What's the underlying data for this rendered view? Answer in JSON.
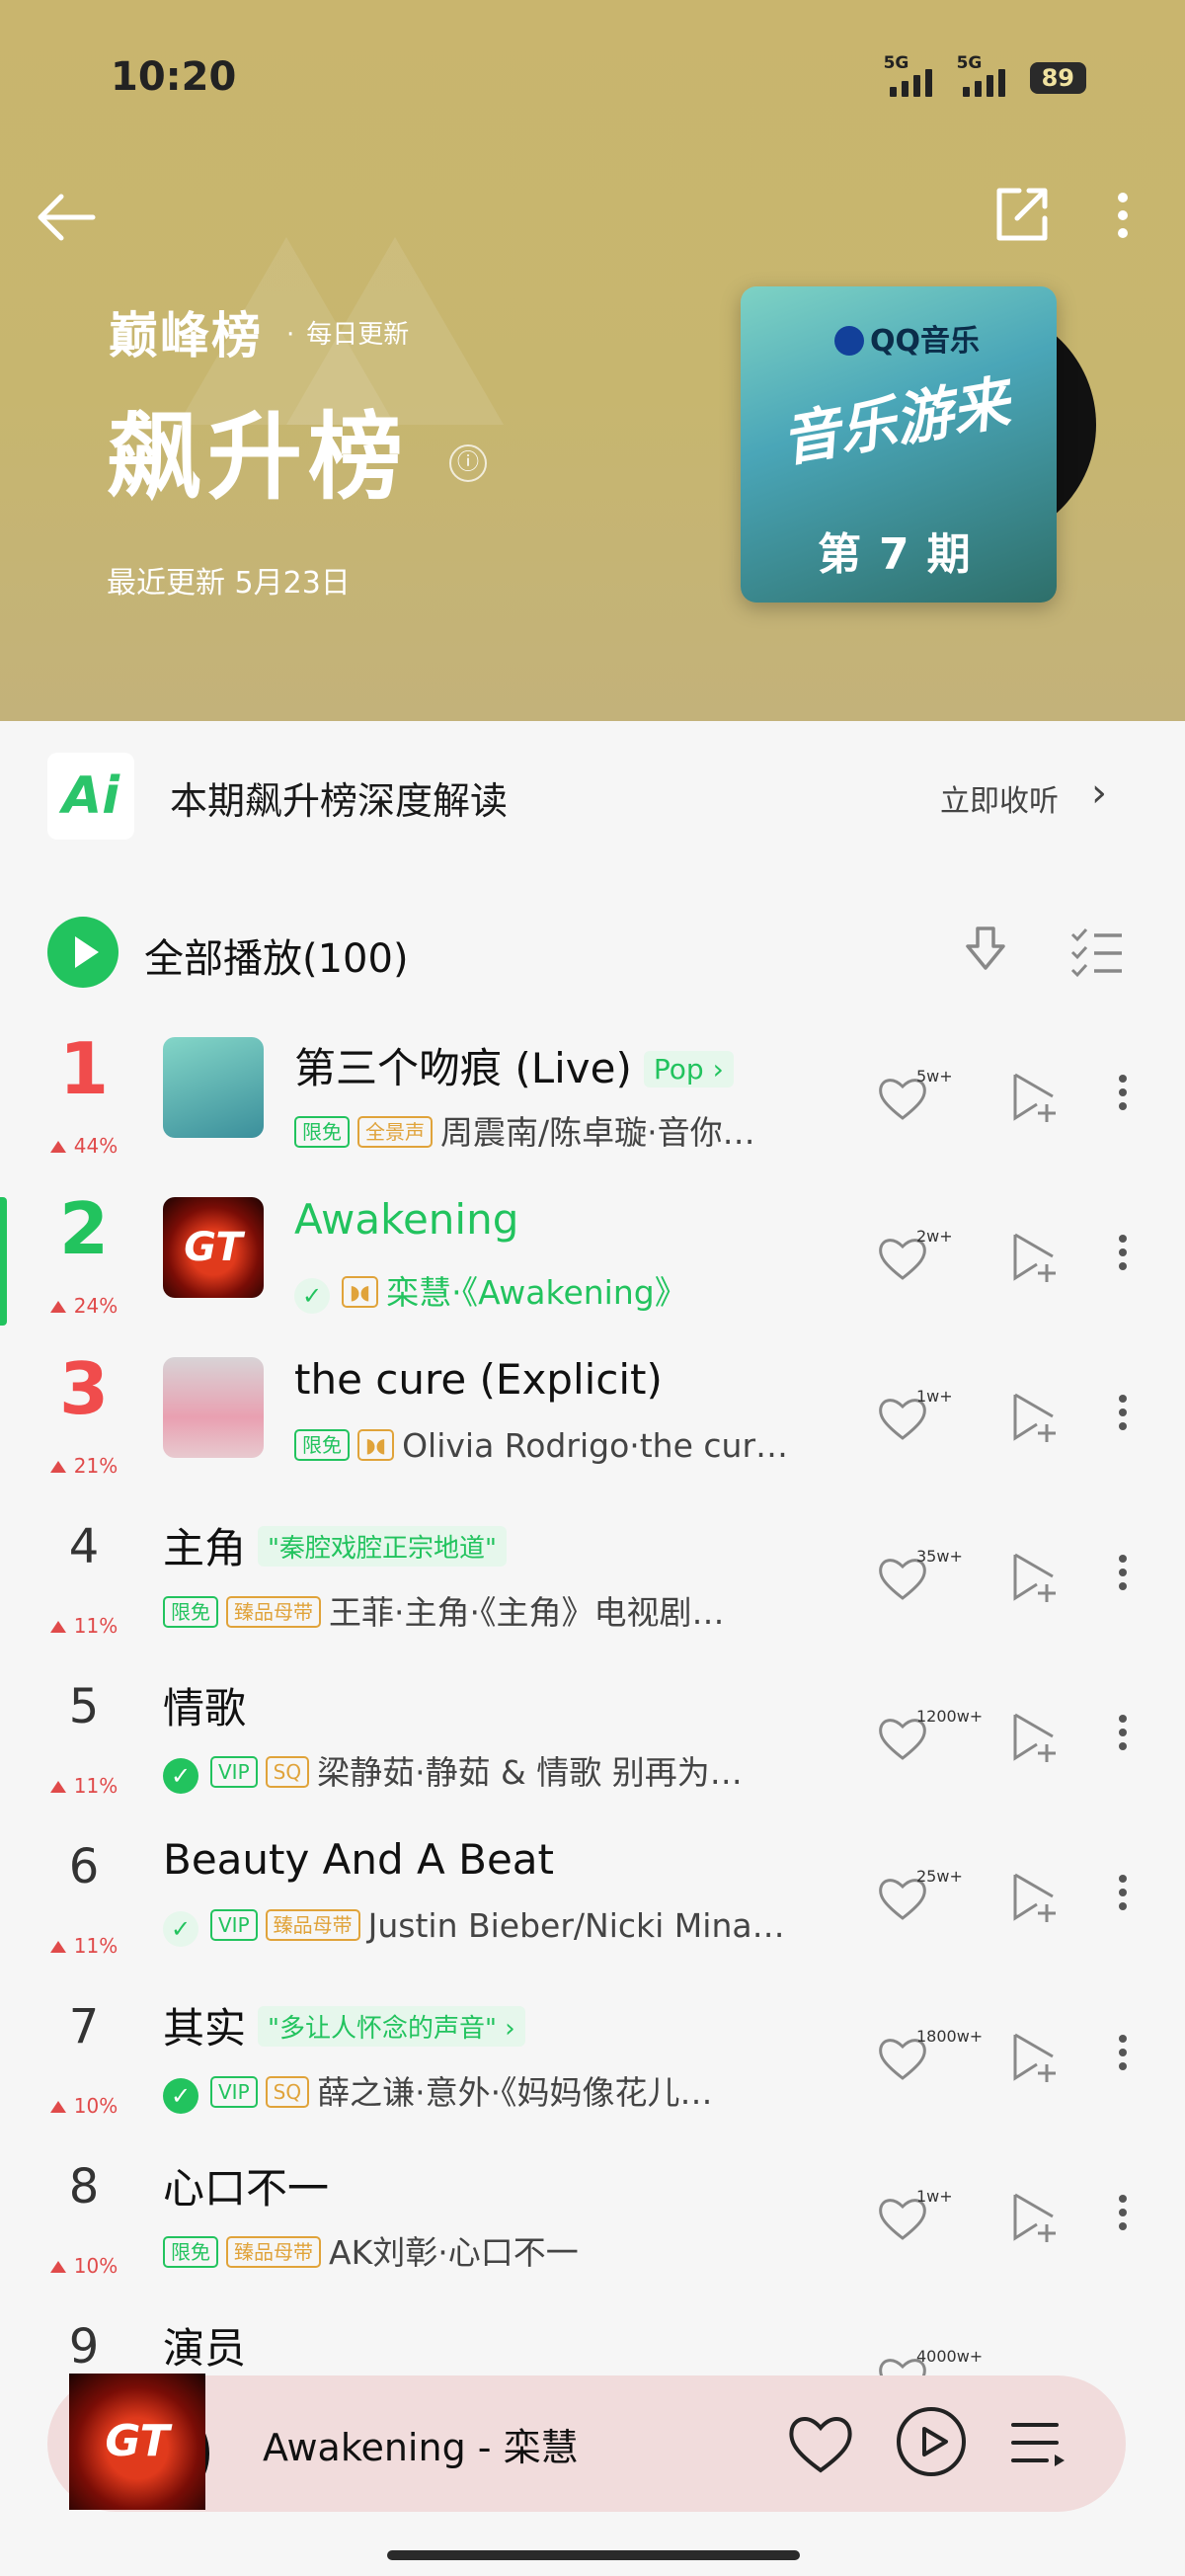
{
  "status_bar": {
    "time": "10:20",
    "signal1_label": "5G",
    "signal2_label": "5G",
    "battery": "89"
  },
  "header": {
    "brand": "巅峰榜",
    "daily": "每日更新",
    "title": "飙升榜",
    "info_icon": "ⓘ",
    "updated": "最近更新 5月23日",
    "cover": {
      "logo": "QQ音乐",
      "art_text": "音乐游来",
      "issue": "第7期"
    },
    "bg_color": "#c7b66f"
  },
  "ai_banner": {
    "logo": "Ai",
    "text": "本期飙升榜深度解读",
    "action": "立即收听"
  },
  "play_all": {
    "label": "全部播放(100)"
  },
  "songs": [
    {
      "rank": "1",
      "trend": "44%",
      "title": "第三个吻痕 (Live)",
      "tag": "Pop",
      "badges": [
        "限免",
        "全景声"
      ],
      "meta": "周震南/陈卓璇·音你…",
      "likes": "5w+"
    },
    {
      "rank": "2",
      "trend": "24%",
      "title": "Awakening",
      "meta": "栾慧·《Awakening》",
      "likes": "2w+",
      "thumb_text": "GT"
    },
    {
      "rank": "3",
      "trend": "21%",
      "title": "the cure (Explicit)",
      "badges": [
        "限免"
      ],
      "meta": "Olivia Rodrigo·the cur…",
      "likes": "1w+"
    },
    {
      "rank": "4",
      "trend": "11%",
      "title": "主角",
      "tag": "\"秦腔戏腔正宗地道\"",
      "badges": [
        "限免",
        "臻品母带"
      ],
      "meta": "王菲·主角·《主角》电视剧…",
      "likes": "35w+"
    },
    {
      "rank": "5",
      "trend": "11%",
      "title": "情歌",
      "badges": [
        "VIP",
        "SQ"
      ],
      "meta": "梁静茹·静茹 & 情歌 别再为…",
      "likes": "1200w+"
    },
    {
      "rank": "6",
      "trend": "11%",
      "title": "Beauty And A Beat",
      "badges": [
        "VIP",
        "臻品母带"
      ],
      "meta": "Justin Bieber/Nicki Mina…",
      "likes": "25w+"
    },
    {
      "rank": "7",
      "trend": "10%",
      "title": "其实",
      "tag": "\"多让人怀念的声音\"",
      "badges": [
        "VIP",
        "SQ"
      ],
      "meta": "薛之谦·意外·《妈妈像花儿…",
      "likes": "1800w+"
    },
    {
      "rank": "8",
      "trend": "10%",
      "title": "心口不一",
      "badges": [
        "限免",
        "臻品母带"
      ],
      "meta": "AK刘彰·心口不一",
      "likes": "1w+"
    },
    {
      "rank": "9",
      "trend": "",
      "title": "演员",
      "likes": "4000w+"
    }
  ],
  "player": {
    "now_playing": "Awakening - 栾慧",
    "art_text": "GT"
  },
  "colors": {
    "accent": "#22c35e",
    "rank_red": "#f04c4c",
    "badge_orange": "#e0a33a"
  }
}
